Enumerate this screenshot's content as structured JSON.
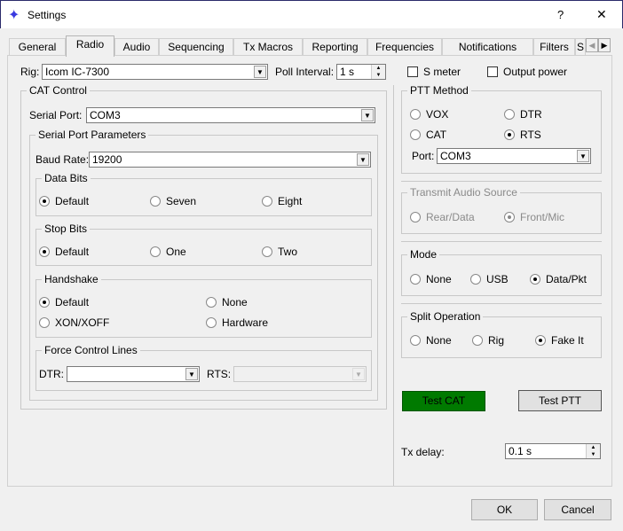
{
  "window": {
    "title": "Settings",
    "help": "?",
    "close": "✕"
  },
  "tabs": [
    {
      "label": "General"
    },
    {
      "label": "Radio"
    },
    {
      "label": "Audio"
    },
    {
      "label": "Sequencing"
    },
    {
      "label": "Tx Macros"
    },
    {
      "label": "Reporting"
    },
    {
      "label": "Frequencies"
    },
    {
      "label": "Notifications"
    },
    {
      "label": "Filters"
    },
    {
      "label": "S"
    }
  ],
  "tab_scroll": {
    "left": "◀",
    "right": "▶"
  },
  "rig": {
    "label": "Rig:",
    "value": "Icom IC-7300",
    "poll_label": "Poll Interval:",
    "poll_value": "1 s",
    "s_meter": "S meter",
    "output_power": "Output power"
  },
  "cat": {
    "title": "CAT Control",
    "serial_port_label": "Serial Port:",
    "serial_port": "COM3",
    "params_title": "Serial Port Parameters",
    "baud_label": "Baud Rate:",
    "baud": "19200",
    "data_bits": {
      "title": "Data Bits",
      "options": [
        "Default",
        "Seven",
        "Eight"
      ],
      "selected": "Default"
    },
    "stop_bits": {
      "title": "Stop Bits",
      "options": [
        "Default",
        "One",
        "Two"
      ],
      "selected": "Default"
    },
    "handshake": {
      "title": "Handshake",
      "options": [
        "Default",
        "None",
        "XON/XOFF",
        "Hardware"
      ],
      "selected": "Default"
    },
    "force": {
      "title": "Force Control Lines",
      "dtr_label": "DTR:",
      "dtr": "",
      "rts_label": "RTS:",
      "rts": ""
    }
  },
  "ptt": {
    "title": "PTT Method",
    "options": [
      "VOX",
      "DTR",
      "CAT",
      "RTS"
    ],
    "selected": "RTS",
    "port_label": "Port:",
    "port": "COM3"
  },
  "audio_source": {
    "title": "Transmit Audio Source",
    "options": [
      "Rear/Data",
      "Front/Mic"
    ],
    "selected": "Front/Mic"
  },
  "mode": {
    "title": "Mode",
    "options": [
      "None",
      "USB",
      "Data/Pkt"
    ],
    "selected": "Data/Pkt"
  },
  "split": {
    "title": "Split Operation",
    "options": [
      "None",
      "Rig",
      "Fake It"
    ],
    "selected": "Fake It"
  },
  "buttons": {
    "test_cat": "Test CAT",
    "test_ptt": "Test PTT",
    "ok": "OK",
    "cancel": "Cancel"
  },
  "tx_delay": {
    "label": "Tx delay:",
    "value": "0.1 s"
  },
  "colors": {
    "test_cat_bg": "#007a00",
    "app_icon": "#3a3ae0"
  }
}
